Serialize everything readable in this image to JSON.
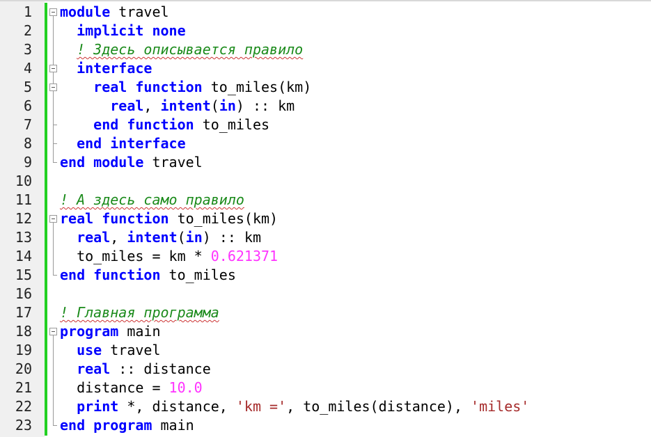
{
  "colors": {
    "keyword": "#0000ff",
    "comment": "#1a8a1a",
    "number": "#ff33ff",
    "string": "#a52a2a",
    "change_bar": "#22d022"
  },
  "lines": [
    {
      "n": "1",
      "tokens": [
        [
          "kw",
          "module"
        ],
        [
          "p",
          " travel"
        ]
      ]
    },
    {
      "n": "2",
      "tokens": [
        [
          "p",
          "  "
        ],
        [
          "kw",
          "implicit none"
        ]
      ]
    },
    {
      "n": "3",
      "tokens": [
        [
          "p",
          "  "
        ],
        [
          "cm",
          "! Здесь описывается правило"
        ]
      ]
    },
    {
      "n": "4",
      "tokens": [
        [
          "p",
          "  "
        ],
        [
          "kw",
          "interface"
        ]
      ]
    },
    {
      "n": "5",
      "tokens": [
        [
          "p",
          "    "
        ],
        [
          "kw",
          "real function"
        ],
        [
          "p",
          " to_miles(km)"
        ]
      ]
    },
    {
      "n": "6",
      "tokens": [
        [
          "p",
          "      "
        ],
        [
          "kw",
          "real"
        ],
        [
          "p",
          ", "
        ],
        [
          "kw",
          "intent"
        ],
        [
          "p",
          "("
        ],
        [
          "kw",
          "in"
        ],
        [
          "p",
          ") :: km"
        ]
      ]
    },
    {
      "n": "7",
      "tokens": [
        [
          "p",
          "    "
        ],
        [
          "kw",
          "end function"
        ],
        [
          "p",
          " to_miles"
        ]
      ]
    },
    {
      "n": "8",
      "tokens": [
        [
          "p",
          "  "
        ],
        [
          "kw",
          "end interface"
        ]
      ]
    },
    {
      "n": "9",
      "tokens": [
        [
          "kw",
          "end module"
        ],
        [
          "p",
          " travel"
        ]
      ]
    },
    {
      "n": "10",
      "tokens": []
    },
    {
      "n": "11",
      "tokens": [
        [
          "cm",
          "! А здесь само правило"
        ]
      ]
    },
    {
      "n": "12",
      "tokens": [
        [
          "kw",
          "real function"
        ],
        [
          "p",
          " to_miles(km)"
        ]
      ]
    },
    {
      "n": "13",
      "tokens": [
        [
          "p",
          "  "
        ],
        [
          "kw",
          "real"
        ],
        [
          "p",
          ", "
        ],
        [
          "kw",
          "intent"
        ],
        [
          "p",
          "("
        ],
        [
          "kw",
          "in"
        ],
        [
          "p",
          ") :: km"
        ]
      ]
    },
    {
      "n": "14",
      "tokens": [
        [
          "p",
          "  to_miles = km * "
        ],
        [
          "num",
          "0.621371"
        ]
      ]
    },
    {
      "n": "15",
      "tokens": [
        [
          "kw",
          "end function"
        ],
        [
          "p",
          " to_miles"
        ]
      ]
    },
    {
      "n": "16",
      "tokens": []
    },
    {
      "n": "17",
      "tokens": [
        [
          "cm",
          "! Главная программа"
        ]
      ]
    },
    {
      "n": "18",
      "tokens": [
        [
          "kw",
          "program"
        ],
        [
          "p",
          " main"
        ]
      ]
    },
    {
      "n": "19",
      "tokens": [
        [
          "p",
          "  "
        ],
        [
          "kw",
          "use"
        ],
        [
          "p",
          " travel"
        ]
      ]
    },
    {
      "n": "20",
      "tokens": [
        [
          "p",
          "  "
        ],
        [
          "kw",
          "real"
        ],
        [
          "p",
          " :: distance"
        ]
      ]
    },
    {
      "n": "21",
      "tokens": [
        [
          "p",
          "  distance = "
        ],
        [
          "num",
          "10.0"
        ]
      ]
    },
    {
      "n": "22",
      "tokens": [
        [
          "p",
          "  "
        ],
        [
          "kw",
          "print"
        ],
        [
          "p",
          " *, distance, "
        ],
        [
          "str",
          "'km ='"
        ],
        [
          "p",
          ", to_miles(distance), "
        ],
        [
          "str",
          "'miles'"
        ]
      ]
    },
    {
      "n": "23",
      "tokens": [
        [
          "kw",
          "end program"
        ],
        [
          "p",
          " main"
        ]
      ]
    }
  ]
}
